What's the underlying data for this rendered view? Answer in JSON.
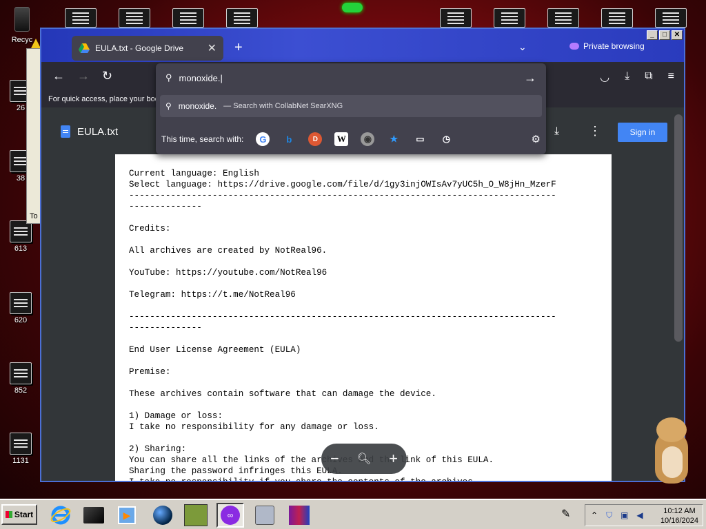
{
  "desktop": {
    "recycle_label": "Recyc",
    "icon_labels": [
      "26",
      "38",
      "613",
      "620",
      "852",
      "1131"
    ],
    "background_window_label": "To"
  },
  "browser": {
    "tab_title": "EULA.txt - Google Drive",
    "private_label": "Private browsing",
    "bookmarks_hint": "For quick access, place your boo",
    "url_value": "monoxide.|",
    "suggestion_text": "monoxide.",
    "suggestion_sub": "— Search with CollabNet SearXNG",
    "search_with_label": "This time, search with:",
    "engines": [
      "google-icon",
      "bing-icon",
      "duckduckgo-icon",
      "wikipedia-icon",
      "searx-icon",
      "bookmarks-icon",
      "tabs-icon",
      "history-icon"
    ]
  },
  "drive": {
    "file_name": "EULA.txt",
    "signin_label": "Sign in"
  },
  "document": {
    "text": "Current language: English\nSelect language: https://drive.google.com/file/d/1gy3injOWIsAv7yUC5h_O_W8jHn_MzerF\n----------------------------------------------------------------------------------\n--------------\n\nCredits:\n\nAll archives are created by NotReal96.\n\nYouTube: https://youtube.com/NotReal96\n\nTelegram: https://t.me/NotReal96\n\n----------------------------------------------------------------------------------\n--------------\n\nEnd User License Agreement (EULA)\n\nPremise:\n\nThese archives contain software that can damage the device.\n\n1) Damage or loss:\nI take no responsibility for any damage or loss.\n\n2) Sharing:\nYou can share all the links of the archives and the link of this EULA.\nSharing the password infringes this EULA.\nI take no responsibility if you share the contents of the archives."
  },
  "taskbar": {
    "start_label": "Start",
    "clock_time": "10:12 AM",
    "clock_date": "10/16/2024"
  },
  "colors": {
    "accent": "#4285f4",
    "titlebar": "#2437b8",
    "desktop": "#7a0a0e"
  }
}
